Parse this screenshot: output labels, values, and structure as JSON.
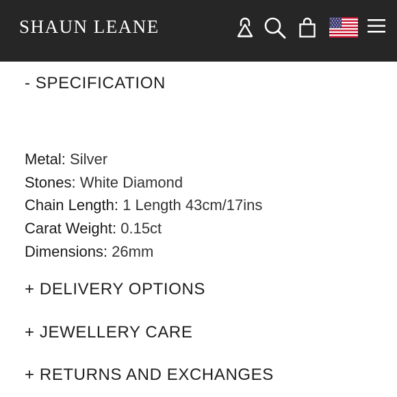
{
  "header": {
    "brand": "SHAUN LEANE",
    "icons": [
      "account-lock-icon",
      "search-icon",
      "bag-icon",
      "us-flag-icon",
      "menu-icon"
    ],
    "colors": {
      "background": "#262626",
      "text": "#ffffff"
    }
  },
  "specification": {
    "toggle": "- SPECIFICATION",
    "rows": [
      {
        "label": "Metal:",
        "value": "Silver"
      },
      {
        "label": "Stones:",
        "value": "White Diamond"
      },
      {
        "label": "Chain Length:",
        "value": "1 Length 43cm/17ins"
      },
      {
        "label": "Carat Weight:",
        "value": "0.15ct"
      },
      {
        "label": "Dimensions:",
        "value": "26mm"
      }
    ]
  },
  "sections": {
    "delivery": "+ DELIVERY OPTIONS",
    "care": "+ JEWELLERY CARE",
    "returns": "+ RETURNS AND EXCHANGES"
  }
}
